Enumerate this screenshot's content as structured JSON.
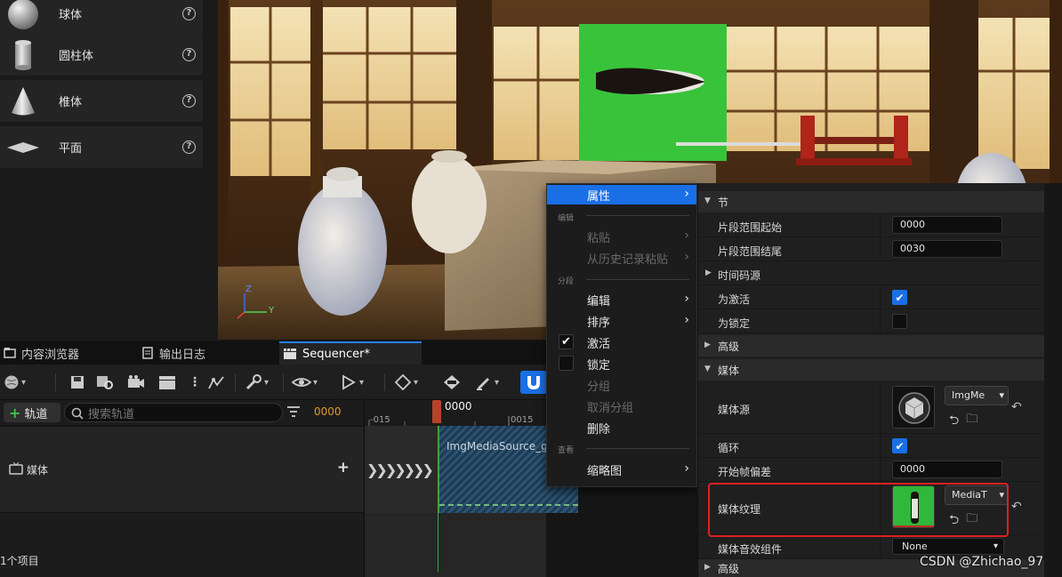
{
  "place_actors": {
    "items": [
      {
        "label": "球体",
        "help": "?"
      },
      {
        "label": "圆柱体",
        "help": "?"
      },
      {
        "label": "椎体",
        "help": "?"
      },
      {
        "label": "平面",
        "help": "?"
      }
    ]
  },
  "viewport": {
    "gizmo_z": "Z",
    "gizmo_y": "Y"
  },
  "tabs": [
    {
      "label": "内容浏览器",
      "icon": "content-browser-icon"
    },
    {
      "label": "输出日志",
      "icon": "output-log-icon"
    },
    {
      "label": "Sequencer*",
      "icon": "clapperboard-icon",
      "active": true
    }
  ],
  "sequencer": {
    "add_track_label": "轨道",
    "search_placeholder": "搜索轨道",
    "current_time": "0000",
    "track_name": "媒体",
    "item_count": "1个项目",
    "timeline": {
      "playhead_label": "0000",
      "tick_left": "-015",
      "tick_right": "0015",
      "section_label": "ImgMediaSource_gi"
    }
  },
  "context_menu": {
    "item_properties": "属性",
    "section_edit": "编辑",
    "item_paste": "粘贴",
    "item_paste_history": "从历史记录粘贴",
    "section_segment": "分段",
    "item_edit": "编辑",
    "item_sort": "排序",
    "item_active": "激活",
    "item_lock": "锁定",
    "item_group": "分组",
    "item_ungroup": "取消分组",
    "item_delete": "删除",
    "section_view": "查看",
    "item_thumbnail": "缩略图"
  },
  "details": {
    "cat_section": "节",
    "range_start_label": "片段范围起始",
    "range_start_value": "0000",
    "range_end_label": "片段范围结尾",
    "range_end_value": "0030",
    "cat_timecode": "时间码源",
    "is_active_label": "为激活",
    "is_active": true,
    "is_locked_label": "为锁定",
    "is_locked": false,
    "cat_advanced": "高级",
    "cat_media": "媒体",
    "media_source_label": "媒体源",
    "media_source_value": "ImgMe",
    "loop_label": "循环",
    "loop": true,
    "start_offset_label": "开始帧偏差",
    "start_offset_value": "0000",
    "media_texture_label": "媒体纹理",
    "media_texture_value": "MediaT",
    "audio_component_label": "媒体音效组件",
    "audio_component_value": "None",
    "cat_advanced_2": "高级"
  },
  "watermark": "CSDN @Zhichao_97",
  "colors": {
    "accent": "#1a6fe6",
    "highlight_box": "#e02020",
    "timecode": "#e09a2a",
    "section_fill": "#2b5574"
  }
}
